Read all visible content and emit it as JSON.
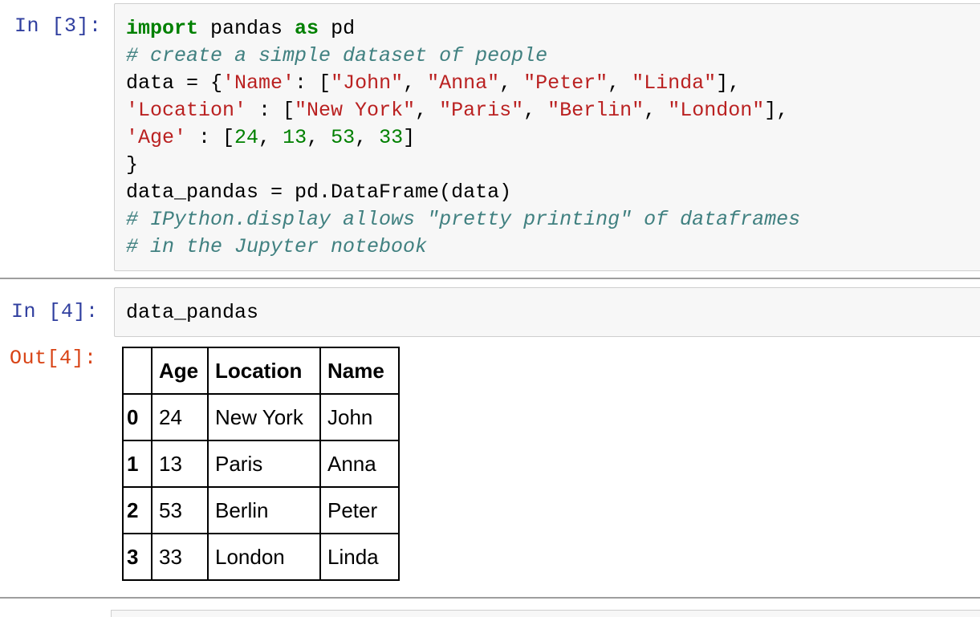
{
  "cell3": {
    "prompt": "In [3]:",
    "lines": [
      [
        {
          "t": "import",
          "c": "kw"
        },
        {
          "t": " pandas ",
          "c": ""
        },
        {
          "t": "as",
          "c": "kw"
        },
        {
          "t": " pd",
          "c": ""
        }
      ],
      [
        {
          "t": "# create a simple dataset of people",
          "c": "cm"
        }
      ],
      [
        {
          "t": "data = {",
          "c": ""
        },
        {
          "t": "'Name'",
          "c": "str"
        },
        {
          "t": ": [",
          "c": ""
        },
        {
          "t": "\"John\"",
          "c": "str"
        },
        {
          "t": ", ",
          "c": ""
        },
        {
          "t": "\"Anna\"",
          "c": "str"
        },
        {
          "t": ", ",
          "c": ""
        },
        {
          "t": "\"Peter\"",
          "c": "str"
        },
        {
          "t": ", ",
          "c": ""
        },
        {
          "t": "\"Linda\"",
          "c": "str"
        },
        {
          "t": "],",
          "c": ""
        }
      ],
      [
        {
          "t": "'Location'",
          "c": "str"
        },
        {
          "t": " : [",
          "c": ""
        },
        {
          "t": "\"New York\"",
          "c": "str"
        },
        {
          "t": ", ",
          "c": ""
        },
        {
          "t": "\"Paris\"",
          "c": "str"
        },
        {
          "t": ", ",
          "c": ""
        },
        {
          "t": "\"Berlin\"",
          "c": "str"
        },
        {
          "t": ", ",
          "c": ""
        },
        {
          "t": "\"London\"",
          "c": "str"
        },
        {
          "t": "],",
          "c": ""
        }
      ],
      [
        {
          "t": "'Age'",
          "c": "str"
        },
        {
          "t": " : [",
          "c": ""
        },
        {
          "t": "24",
          "c": "num"
        },
        {
          "t": ", ",
          "c": ""
        },
        {
          "t": "13",
          "c": "num"
        },
        {
          "t": ", ",
          "c": ""
        },
        {
          "t": "53",
          "c": "num"
        },
        {
          "t": ", ",
          "c": ""
        },
        {
          "t": "33",
          "c": "num"
        },
        {
          "t": "]",
          "c": ""
        }
      ],
      [
        {
          "t": "}",
          "c": ""
        }
      ],
      [
        {
          "t": "data_pandas = pd.DataFrame(data)",
          "c": ""
        }
      ],
      [
        {
          "t": "# IPython.display allows \"pretty printing\" of dataframes",
          "c": "cm"
        }
      ],
      [
        {
          "t": "# in the Jupyter notebook",
          "c": "cm"
        }
      ]
    ]
  },
  "cell4": {
    "prompt": "In [4]:",
    "code": "data_pandas",
    "out_prompt": "Out[4]:",
    "table": {
      "columns": [
        "",
        "Age",
        "Location",
        "Name"
      ],
      "rows": [
        {
          "index": "0",
          "age": "24",
          "location": "New York",
          "name": "John"
        },
        {
          "index": "1",
          "age": "13",
          "location": "Paris",
          "name": "Anna"
        },
        {
          "index": "2",
          "age": "53",
          "location": "Berlin",
          "name": "Peter"
        },
        {
          "index": "3",
          "age": "33",
          "location": "London",
          "name": "Linda"
        }
      ]
    }
  },
  "colors": {
    "prompt_in": "#303f9f",
    "prompt_out": "#d84315",
    "keyword": "#008000",
    "string": "#ba2121",
    "number": "#008000",
    "comment": "#408080",
    "cell_background": "#f7f7f7"
  }
}
